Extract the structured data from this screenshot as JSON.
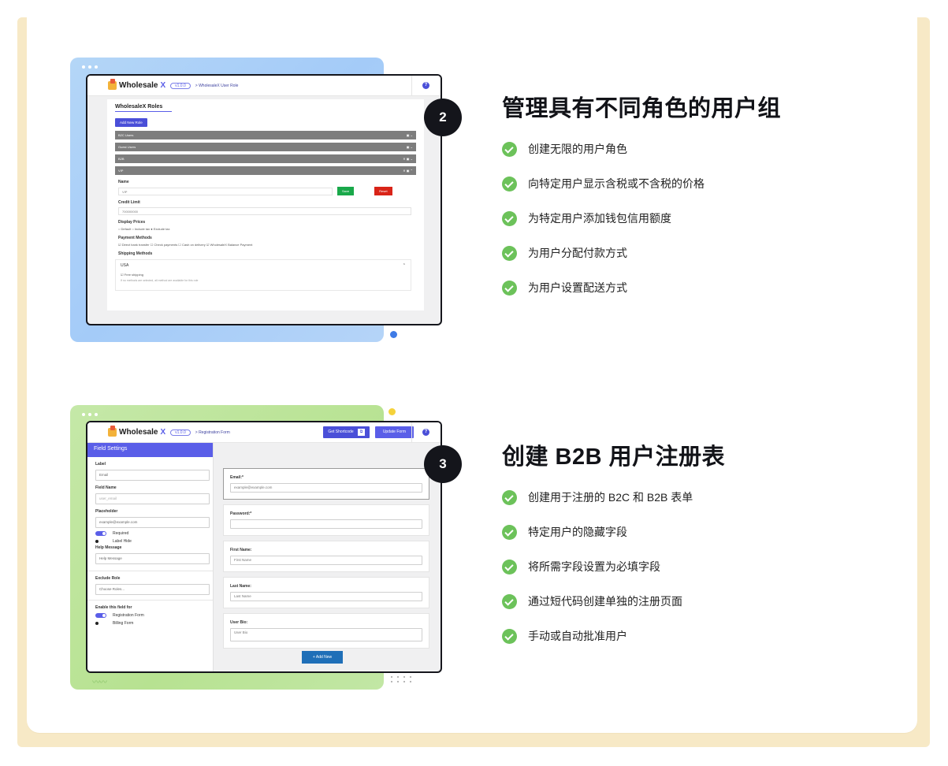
{
  "section2": {
    "badge": "2",
    "title": "管理具有不同角色的用户组",
    "features": [
      "创建无限的用户角色",
      "向特定用户显示含税或不含税的价格",
      "为特定用户添加钱包信用额度",
      "为用户分配付款方式",
      "为用户设置配送方式"
    ],
    "app": {
      "logo_a": "Wholesale",
      "logo_b": "X",
      "version": "v1.0.0",
      "crumb": "> WholesaleX User Role",
      "roles_title": "WholesaleX Roles",
      "add_button": "Add New Role",
      "roles": [
        "B2C Users",
        "Guest Users",
        "B2B",
        "VIP"
      ],
      "name_label": "Name",
      "name_value": "VIP",
      "save": "Save",
      "reset": "Reset",
      "credit_label": "Credit Limit",
      "credit_value": "700000000",
      "display_label": "Display Prices",
      "display_options": "○ Default   ○ Include tax   ● Exclude tax",
      "payment_label": "Payment Methods",
      "payment_options": "☑ Direct bank transfer   ☐ Check payments   ☐ Cash on delivery   ☑ WholesaleX Balance Payment",
      "shipping_label": "Shipping Methods",
      "shipping_zone": "USA",
      "free_shipping": "☑ Free shipping",
      "shipping_note": "If no methods are selected, all method are available for this role"
    }
  },
  "section3": {
    "badge": "3",
    "title": "创建 B2B 用户注册表",
    "features": [
      "创建用于注册的 B2C 和 B2B 表单",
      "特定用户的隐藏字段",
      "将所需字段设置为必填字段",
      "通过短代码创建单独的注册页面",
      "手动或自动批准用户"
    ],
    "app": {
      "logo_a": "Wholesale",
      "logo_b": "X",
      "version": "v1.0.0",
      "crumb": "> Registration Form",
      "get_shortcode": "Get Shortcode",
      "update_form": "Update Form",
      "field_settings": "Field Settings",
      "label_l": "Label",
      "label_v": "Email",
      "fname_l": "Field Name",
      "fname_v": "user_email",
      "ph_l": "Placeholder",
      "ph_v": "example@example.com",
      "required": "Required",
      "label_hide": "Label Hide",
      "help_l": "Help Message",
      "help_v": "Help Message",
      "exclude_l": "Exclude Role",
      "exclude_v": "Choose Roles...",
      "enable_l": "Enable this field for",
      "reg_form": "Registration Form",
      "billing_form": "Billing Form",
      "email_l": "Email:*",
      "email_v": "example@example.com",
      "pass_l": "Password:*",
      "first_l": "First Name:",
      "first_v": "First Name",
      "last_l": "Last Name:",
      "last_v": "Last Name",
      "bio_l": "User Bio:",
      "bio_v": "User Bio",
      "add_new": "+  Add New"
    }
  }
}
